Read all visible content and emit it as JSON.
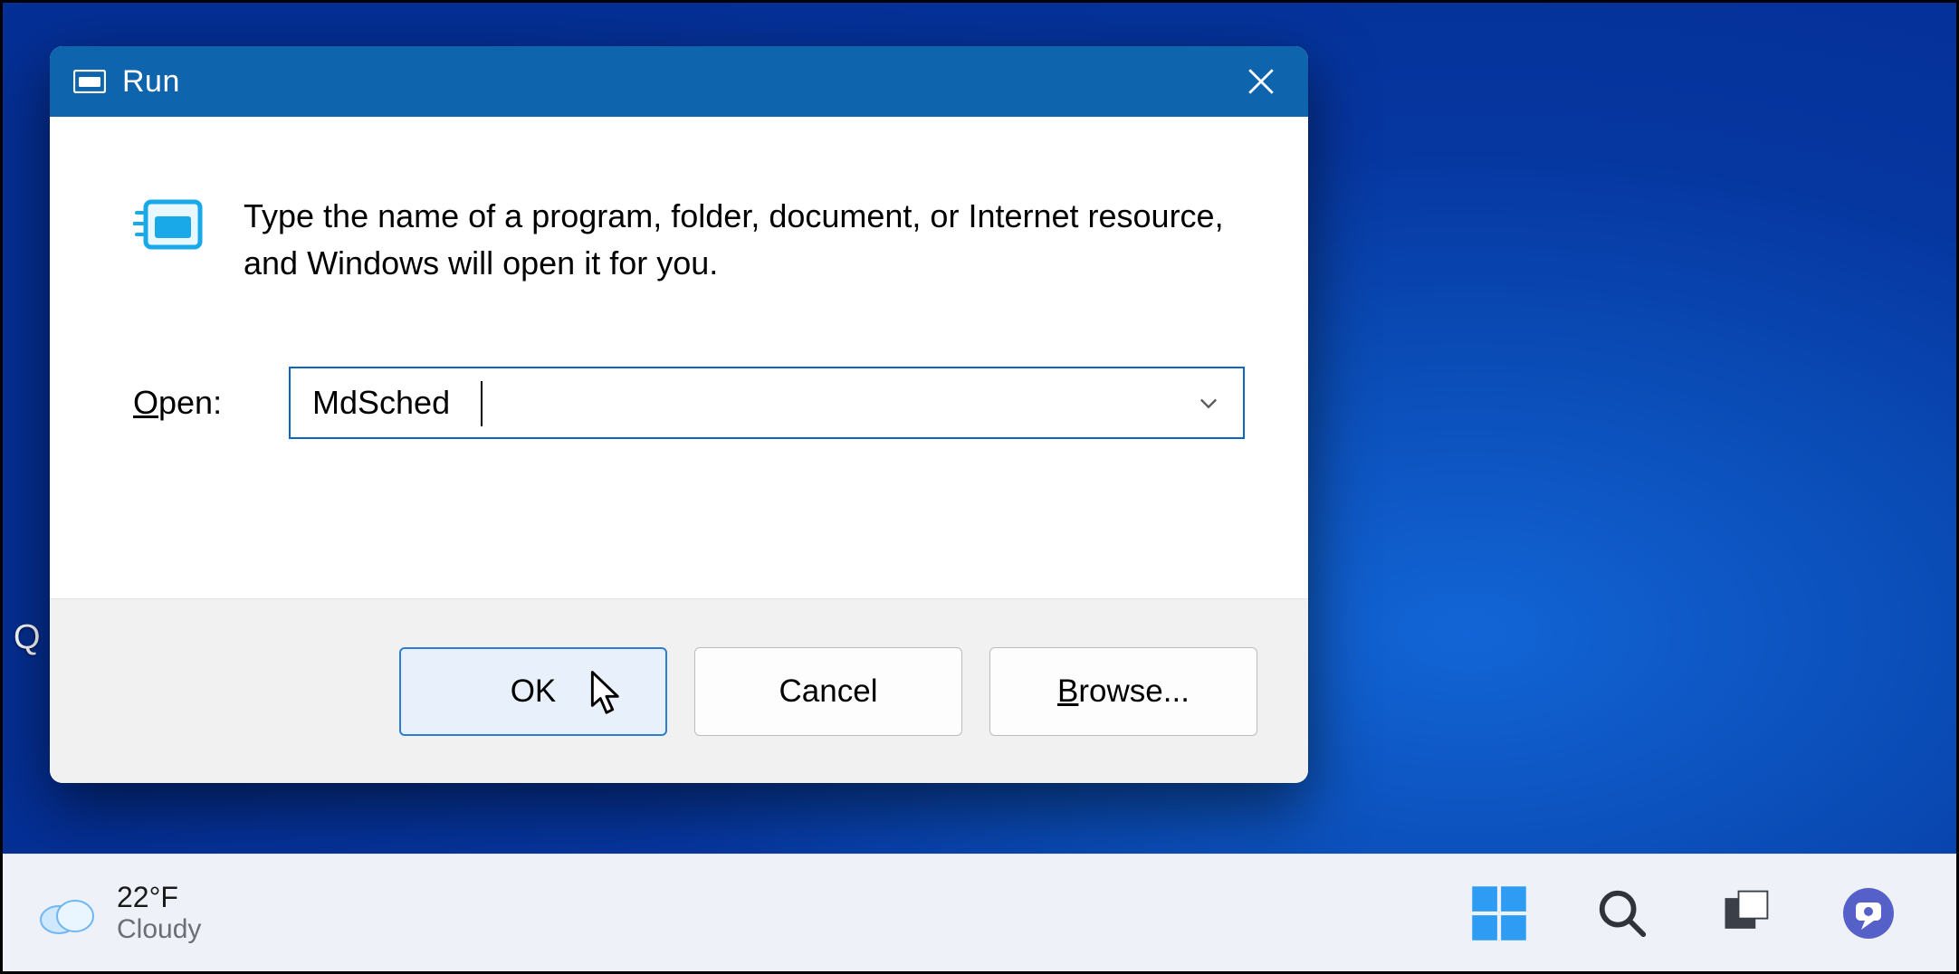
{
  "dialog": {
    "title": "Run",
    "hint": "Type the name of a program, folder, document, or Internet resource, and Windows will open it for you.",
    "open_label_prefix": "O",
    "open_label_rest": "pen:",
    "input_value": "MdSched",
    "buttons": {
      "ok": "OK",
      "cancel": "Cancel",
      "browse_prefix": "B",
      "browse_rest": "rowse..."
    }
  },
  "desktop": {
    "icon_fragment": "Q"
  },
  "taskbar": {
    "weather": {
      "temp": "22°F",
      "condition": "Cloudy"
    }
  }
}
